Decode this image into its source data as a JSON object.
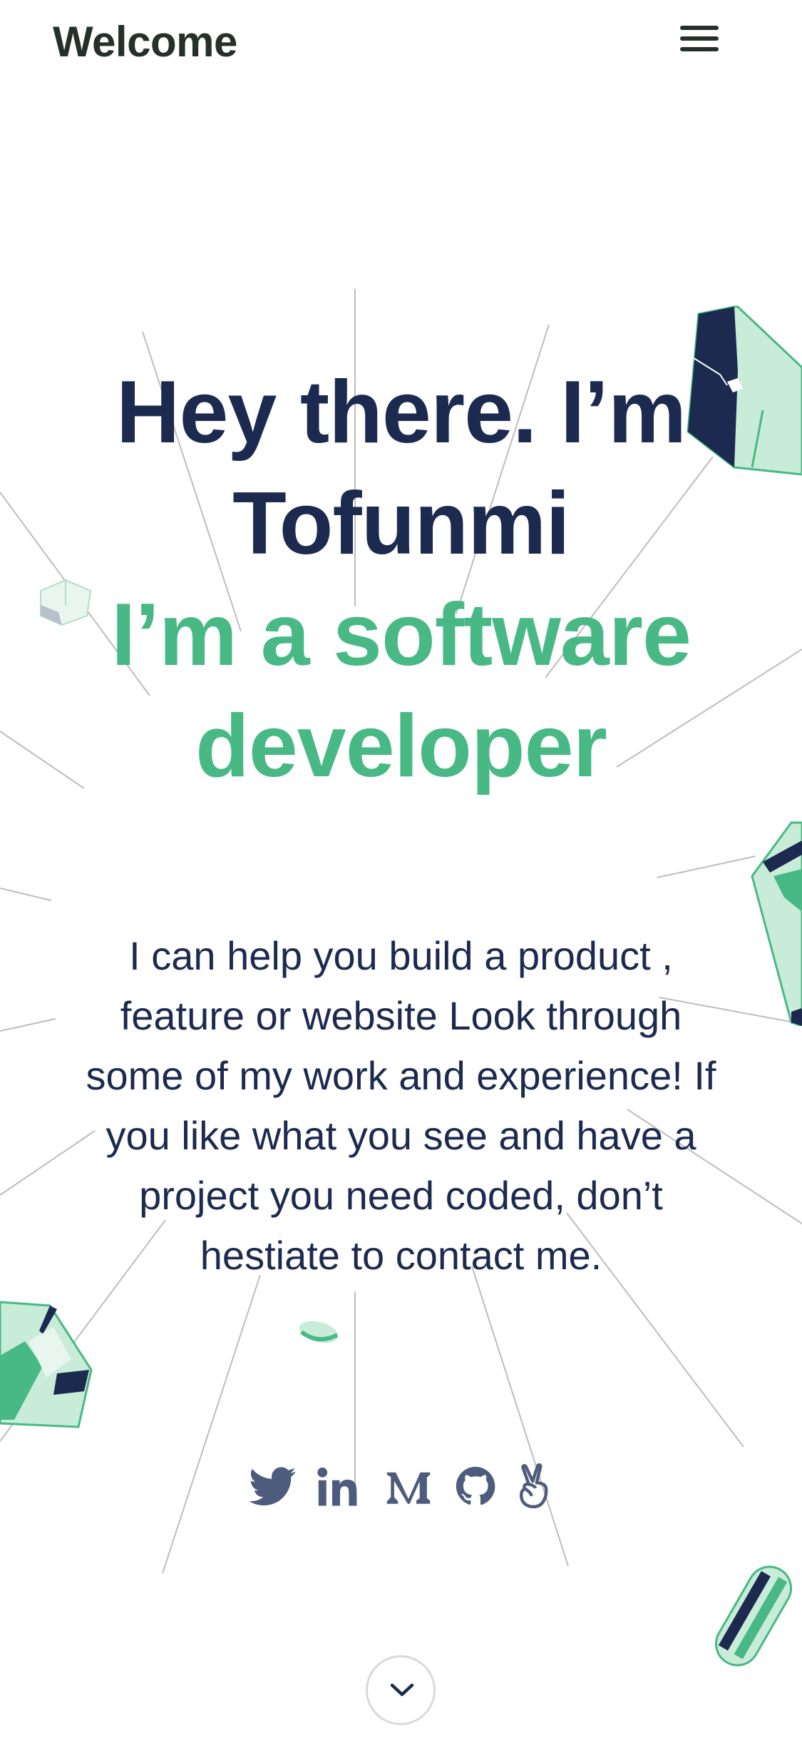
{
  "header": {
    "title": "Welcome",
    "menu_icon": "hamburger-menu-icon"
  },
  "hero": {
    "greeting_line1": "Hey there. I’m",
    "greeting_line2": "Tofunmi",
    "role_line1": "I’m a software",
    "role_line2": "developer"
  },
  "intro": {
    "text": "I can help you build a product , feature or website Look through some of my work and experience! If you like what you see and have a project you need coded, don’t hestiate to contact me."
  },
  "socials": [
    {
      "name": "twitter",
      "icon": "twitter-icon"
    },
    {
      "name": "linkedin",
      "icon": "linkedin-icon"
    },
    {
      "name": "medium",
      "icon": "medium-icon"
    },
    {
      "name": "github",
      "icon": "github-icon"
    },
    {
      "name": "angellist",
      "icon": "angellist-icon"
    }
  ],
  "scroll_button": {
    "icon": "chevron-down-icon"
  },
  "colors": {
    "navy": "#1b2a4e",
    "green": "#48b985",
    "light_green": "#c9ecd9",
    "icon_slate": "#4d5b7c",
    "header_text": "#25302a"
  }
}
